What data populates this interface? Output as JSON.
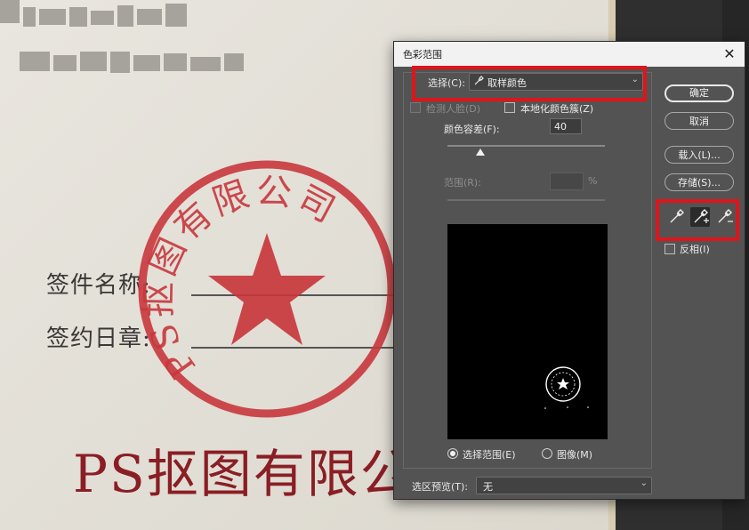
{
  "document": {
    "field1_label": "签件名称:",
    "field2_label": "签约日章:",
    "company_text": "PS抠图有限公",
    "seal_text": "PS抠图有限公司"
  },
  "dialog": {
    "title": "色彩范围",
    "close_glyph": "✕",
    "select_label": "选择(C):",
    "select_value": "取样颜色",
    "detect_faces_label": "检测人脸(D)",
    "localized_clusters_label": "本地化颜色簇(Z)",
    "fuzziness_label": "颜色容差(F):",
    "fuzziness_value": "40",
    "range_label": "范围(R):",
    "range_unit": "%",
    "radio_selection_label": "选择范围(E)",
    "radio_image_label": "图像(M)",
    "selection_preview_label": "选区预览(T):",
    "selection_preview_value": "无",
    "ok_label": "确定",
    "cancel_label": "取消",
    "load_label": "载入(L)...",
    "save_label": "存储(S)...",
    "invert_label": "反相(I)"
  },
  "colors": {
    "seal_red": "#c8373c",
    "highlight_red": "#e0141b",
    "dialog_bg": "#535353"
  }
}
